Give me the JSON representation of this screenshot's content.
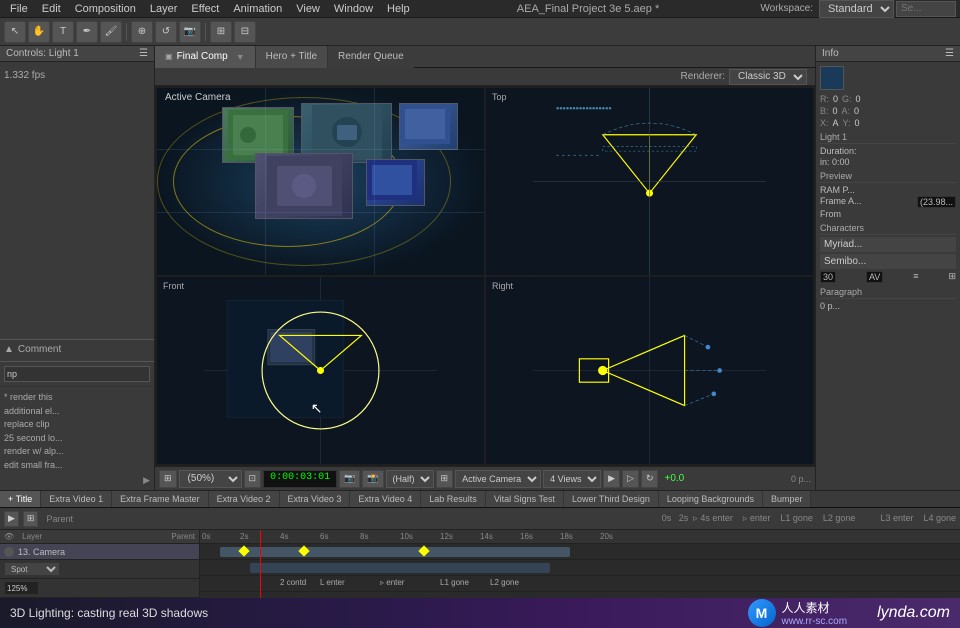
{
  "menu": {
    "items": [
      "File",
      "Edit",
      "Composition",
      "Layer",
      "Effect",
      "Animation",
      "View",
      "Window",
      "Help"
    ]
  },
  "window_title": "AEA_Final Project 3e 5.aep *",
  "toolbar": {
    "workspace_label": "Workspace:",
    "workspace_value": "Standard",
    "search_placeholder": "Se..."
  },
  "comp_tabs": {
    "final_comp": "Final Comp",
    "hero_title": "Hero + Title",
    "render_queue": "Render Queue"
  },
  "renderer": {
    "label": "Renderer:",
    "value": "Classic 3D"
  },
  "viewport": {
    "active_camera": "Active Camera",
    "top_label": "Top",
    "front_label": "Front",
    "right_label": "Right",
    "percent": "(50%)",
    "timecode": "0:00:03:01",
    "quality": "(Half)",
    "view_mode": "Active Camera",
    "views": "4 Views",
    "plus_value": "+0.0"
  },
  "right_panel": {
    "title": "Info",
    "rgb": {
      "r": "R:",
      "g": "G:",
      "b": "B:",
      "a": "A:"
    },
    "r_val": "0",
    "g_val": "0",
    "b_val": "0",
    "a_val": "0",
    "x_val": "A",
    "y_val": "0",
    "light_title": "Light 1",
    "duration": "Duration:",
    "dur_val": "in: 0:00",
    "preview_title": "RAM P...",
    "frame_label": "Frame A...",
    "frame_rate": "(23.98...",
    "from_label": "From",
    "font_name": "Myriad...",
    "font_style": "Semibo...",
    "font_size": "30",
    "av_label": "AV",
    "para_title": "Paragra...",
    "para_val": "0 p..."
  },
  "bottom_tabs": [
    "+ Title",
    "Extra Video 1",
    "Extra Frame Master",
    "Extra Video 2",
    "Extra Video 3",
    "Extra Video 4",
    "Lab Results",
    "Vital Signs Test",
    "Lower Third Design",
    "Looping Backgrounds",
    "Bumper"
  ],
  "timeline": {
    "layer_name": "13. Camera",
    "layer_type": "Spot",
    "layer_pct": "125%",
    "ruler_marks": [
      "0s",
      "2s",
      "4s",
      "6s",
      "8s",
      "10s",
      "12s",
      "14s",
      "16s",
      "18s",
      "20s"
    ],
    "track_labels": [
      "2 contd",
      "L enter",
      "enter",
      "L1 gone",
      "L2 gone",
      "L3 enter",
      "L4 gone"
    ]
  },
  "bottom_bar": {
    "text": "3D Lighting: casting real 3D shadows",
    "logo_icon": "M",
    "logo_name": "人人素材",
    "logo_url": "www.rr-sc.com",
    "lynda": "lynda.com"
  }
}
